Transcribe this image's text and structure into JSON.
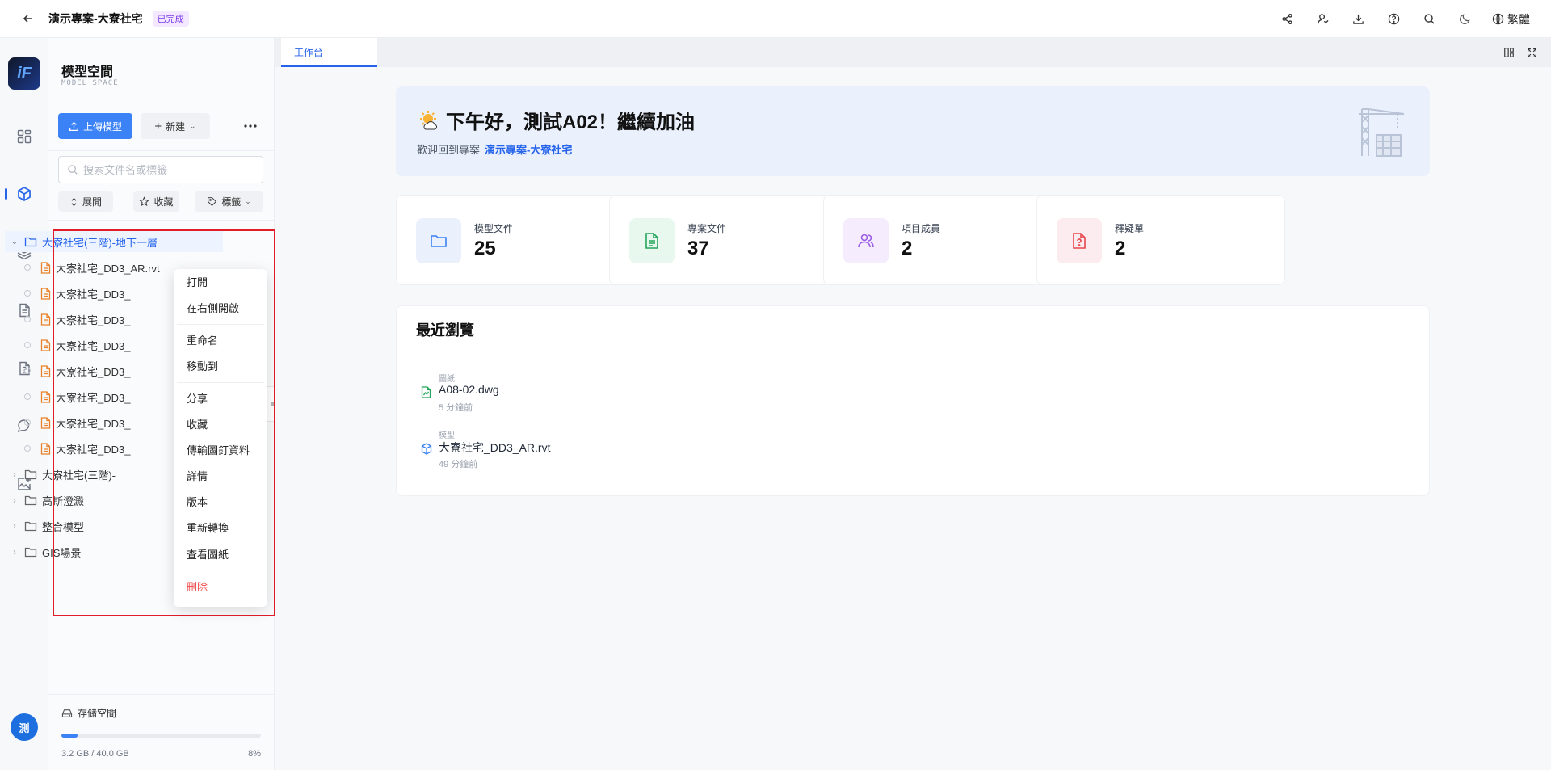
{
  "header": {
    "project_title": "演示專案-大寮社宅",
    "status": "已完成",
    "language": "繁體"
  },
  "rail": {
    "user_initial": "測"
  },
  "sidebar": {
    "title": "模型空間",
    "subtitle": "MODEL SPACE",
    "upload_label": "上傳模型",
    "new_label": "新建",
    "search_placeholder": "搜索文件名或標籤",
    "filters": {
      "expand": "展開",
      "favorite": "收藏",
      "tags": "標籤"
    },
    "tree": [
      {
        "type": "folder",
        "label": "大寮社宅(三階)-地下一層",
        "open": true
      },
      {
        "type": "file",
        "label": "大寮社宅_DD3_AR.rvt"
      },
      {
        "type": "file",
        "label": "大寮社宅_DD3_"
      },
      {
        "type": "file",
        "label": "大寮社宅_DD3_"
      },
      {
        "type": "file",
        "label": "大寮社宅_DD3_"
      },
      {
        "type": "file",
        "label": "大寮社宅_DD3_"
      },
      {
        "type": "file",
        "label": "大寮社宅_DD3_"
      },
      {
        "type": "file",
        "label": "大寮社宅_DD3_"
      },
      {
        "type": "file",
        "label": "大寮社宅_DD3_"
      },
      {
        "type": "folder",
        "label": "大寮社宅(三階)-",
        "open": false
      },
      {
        "type": "folder",
        "label": "高斯澄澱",
        "open": false
      },
      {
        "type": "folder",
        "label": "整合模型",
        "open": false
      },
      {
        "type": "folder",
        "label": "GIS場景",
        "open": false
      }
    ],
    "storage": {
      "label": "存储空間",
      "used_text": "3.2 GB / 40.0 GB",
      "percent_text": "8%",
      "percent": 8
    }
  },
  "context_menu": {
    "items": [
      "打開",
      "在右側開啟",
      "重命名",
      "移動到",
      "分享",
      "收藏",
      "傳輸圖釘資料",
      "詳情",
      "版本",
      "重新轉換",
      "查看圖紙",
      "刪除"
    ]
  },
  "main": {
    "tab_label": "工作台",
    "welcome": {
      "greeting": "下午好，測試A02！繼續加油",
      "sub_prefix": "歡迎回到專案",
      "project_link": "演示專案-大寮社宅"
    },
    "stats": [
      {
        "label": "模型文件",
        "value": "25",
        "icon": "folder-icon",
        "bg": "#eaf1fd",
        "fg": "#3b82f6"
      },
      {
        "label": "專案文件",
        "value": "37",
        "icon": "document-icon",
        "bg": "#e8f8ef",
        "fg": "#22a55a"
      },
      {
        "label": "項目成員",
        "value": "2",
        "icon": "members-icon",
        "bg": "#f5ecfd",
        "fg": "#9b5de5"
      },
      {
        "label": "釋疑單",
        "value": "2",
        "icon": "question-doc-icon",
        "bg": "#fdecef",
        "fg": "#e5484d"
      }
    ],
    "recent": {
      "title": "最近瀏覽",
      "items": [
        {
          "category": "圖紙",
          "name": "A08-02.dwg",
          "time": "5 分鐘前"
        },
        {
          "category": "模型",
          "name": "大寮社宅_DD3_AR.rvt",
          "time": "49 分鐘前"
        }
      ]
    }
  },
  "colors": {
    "accent": "#2563eb",
    "highlight_border": "#e11d2a",
    "danger": "#ef4444"
  }
}
